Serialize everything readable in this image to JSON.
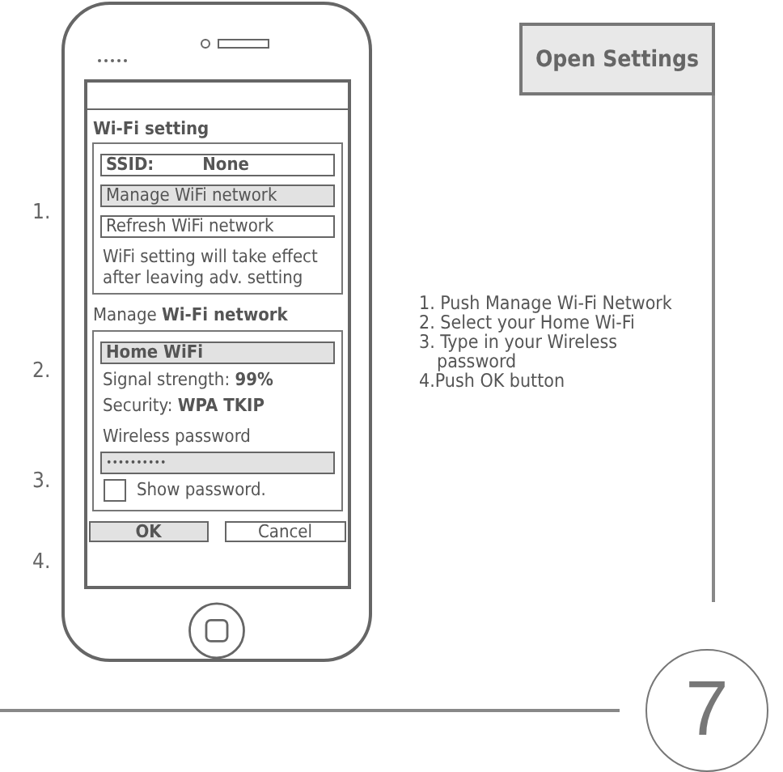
{
  "phone": {
    "screen": {
      "section_title": "Wi-Fi setting",
      "ssid_label": "SSID:",
      "ssid_value": "None",
      "buttons": [
        {
          "label": "Manage WiFi network",
          "selected": true
        },
        {
          "label": "Refresh WiFi network",
          "selected": false
        }
      ],
      "note": "WiFi setting will take effect after leaving adv. setting",
      "manage_title": "Manage **Wi-Fi network**",
      "network": {
        "name": "Home WiFi",
        "selected": true
      },
      "signal": "Signal strength: **99%**",
      "security": "Security: **WPA TKIP**",
      "password_label": "Wireless password",
      "password_value": "••••••••••",
      "show_password": {
        "label": "Show password.",
        "checked": false
      },
      "actions": [
        {
          "label": "OK",
          "selected": true
        },
        {
          "label": "Cancel",
          "selected": false
        }
      ]
    }
  },
  "step_markers": [
    "1.",
    "2.",
    "3.",
    "4."
  ],
  "open_settings": "Open Settings",
  "instructions": [
    "1. Push Manage Wi-Fi Network",
    "2. Select your Home Wi-Fi",
    "3. Type in your Wireless password",
    "4.Push OK button"
  ],
  "page_number": "7"
}
